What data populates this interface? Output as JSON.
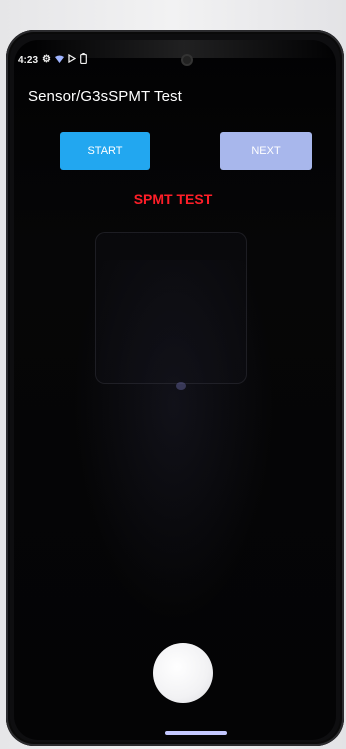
{
  "status_bar": {
    "time": "4:23",
    "icons": [
      "gear-icon",
      "wifi-icon",
      "play-icon",
      "battery-icon"
    ]
  },
  "app": {
    "title": "Sensor/G3sSPMT Test"
  },
  "buttons": {
    "start_label": "START",
    "next_label": "NEXT"
  },
  "test": {
    "label": "SPMT TEST"
  },
  "colors": {
    "start_button": "#22a7f0",
    "next_button": "#a8b7ec",
    "test_label": "#ff1e28",
    "screen_background": "#050506"
  }
}
